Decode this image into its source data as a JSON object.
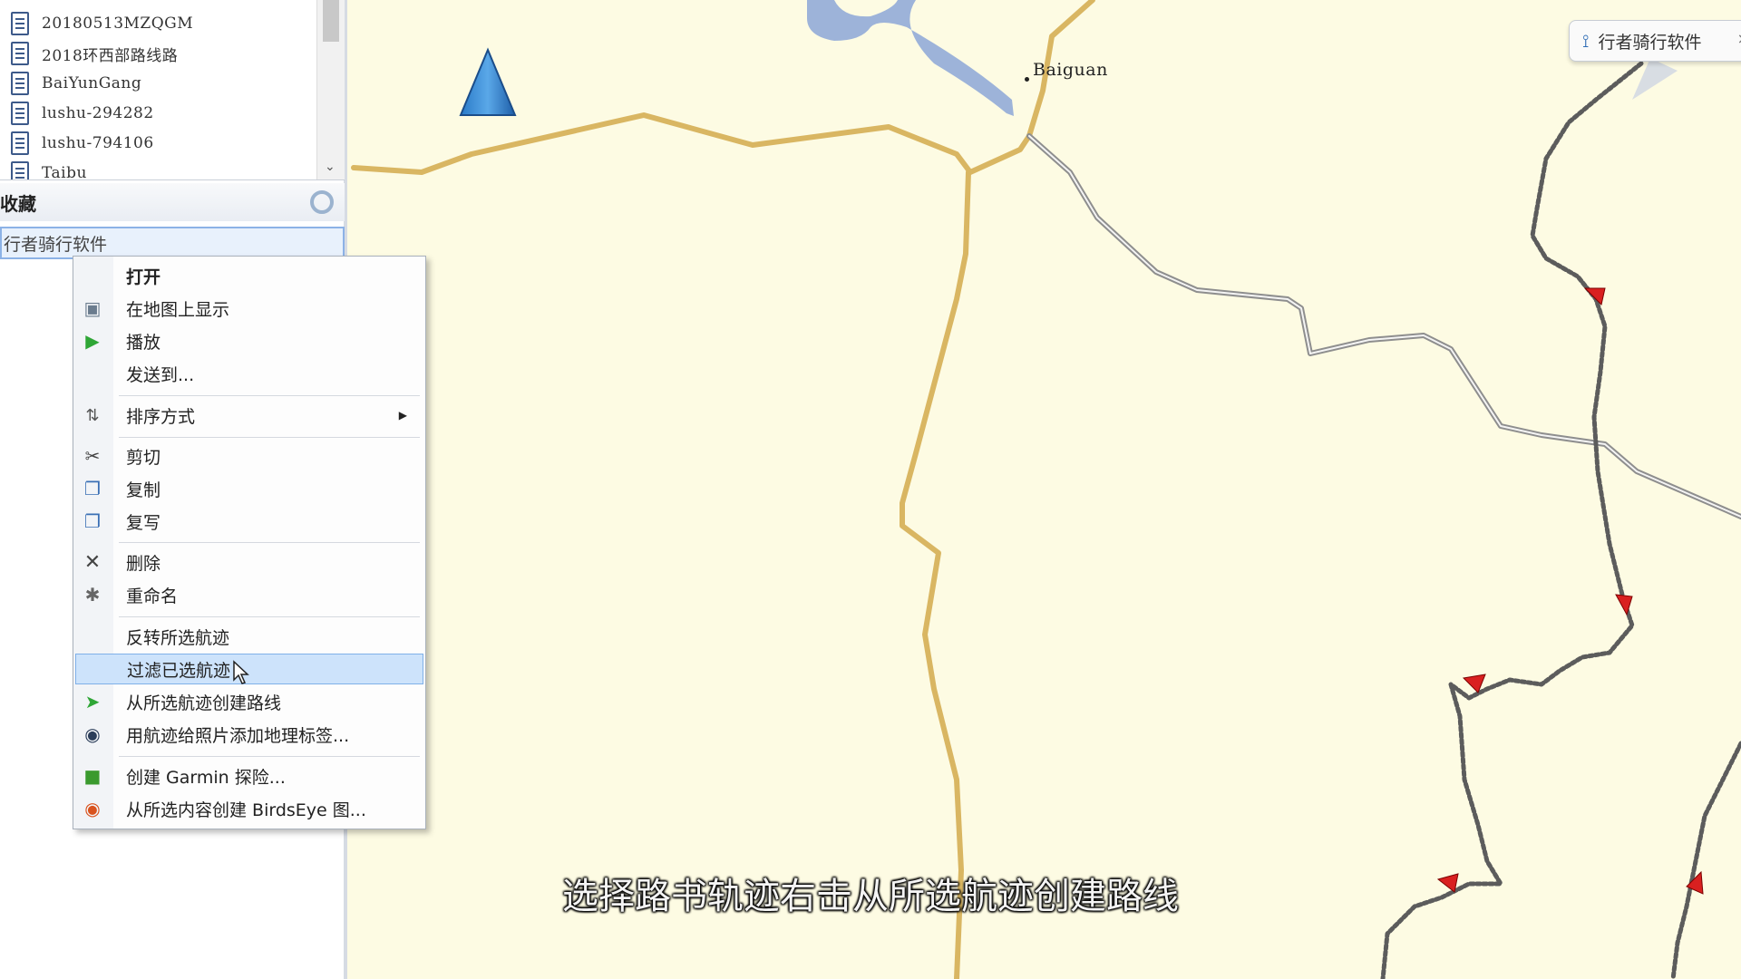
{
  "file_list": {
    "items": [
      {
        "label": "20180513MZQGM"
      },
      {
        "label": "2018环西部路线路"
      },
      {
        "label": "BaiYunGang"
      },
      {
        "label": "lushu-294282"
      },
      {
        "label": "lushu-794106"
      },
      {
        "label": "Taibu"
      }
    ]
  },
  "section": {
    "title": "收藏",
    "gear_icon": "gear-icon"
  },
  "selected_item": {
    "label": "行者骑行软件"
  },
  "context_menu": {
    "items": [
      {
        "label": "打开",
        "icon": "",
        "bold": true
      },
      {
        "label": "在地图上显示",
        "icon": "map-show-icon"
      },
      {
        "label": "播放",
        "icon": "play-icon"
      },
      {
        "label": "发送到...",
        "icon": ""
      },
      {
        "label": "排序方式",
        "icon": "sort-icon",
        "submenu": true
      },
      {
        "label": "剪切",
        "icon": "scissors-icon"
      },
      {
        "label": "复制",
        "icon": "copy-icon"
      },
      {
        "label": "复写",
        "icon": "duplicate-icon"
      },
      {
        "label": "删除",
        "icon": "delete-icon"
      },
      {
        "label": "重命名",
        "icon": "rename-icon"
      },
      {
        "label": "反转所选航迹",
        "icon": ""
      },
      {
        "label": "过滤已选航迹",
        "icon": "",
        "highlighted": true
      },
      {
        "label": "从所选航迹创建路线",
        "icon": "route-icon"
      },
      {
        "label": "用航迹给照片添加地理标签...",
        "icon": "camera-icon"
      },
      {
        "label": "创建 Garmin 探险...",
        "icon": "adventure-icon"
      },
      {
        "label": "从所选内容创建 BirdsEye 图...",
        "icon": "birdseye-icon"
      }
    ]
  },
  "map": {
    "place_label": "Baiguan",
    "tab_label": "行者骑行软件"
  },
  "subtitle": "选择路书轨迹右击从所选航迹创建路线",
  "colors": {
    "map_background": "#fdfbe3",
    "road": "#d9b662",
    "track": "#9a9a9a",
    "water": "#9db3d9",
    "highlight": "#cde3fb",
    "arrow": "#d92020"
  }
}
